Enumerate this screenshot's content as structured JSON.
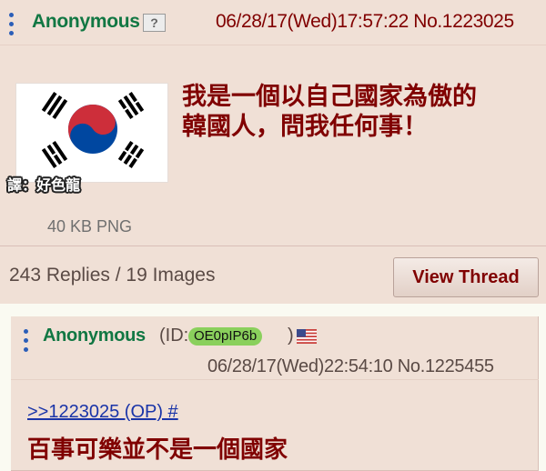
{
  "op": {
    "name": "Anonymous",
    "help_badge": "?",
    "datetime": "06/28/17(Wed)17:57:22 No.1223025",
    "image_credit": "譯：好色龍",
    "file_info": "40 KB PNG",
    "comment_line1": "我是一個以自己國家為傲的",
    "comment_line2": "韓國人，問我任何事！",
    "replies_summary": "243 Replies / 19 Images",
    "view_thread_label": "View Thread"
  },
  "reply": {
    "name": "Anonymous",
    "id_prefix": "(ID:",
    "poster_id": "OE0pIP6b",
    "id_suffix": ")",
    "flag_icon": "us-flag-icon",
    "datetime": "06/28/17(Wed)22:54:10 No.1225455",
    "quotelink": ">>1223025 (OP) #",
    "comment": "百事可樂並不是一個國家"
  },
  "colors": {
    "post_bg": "#f0e0d6",
    "name_green": "#117743",
    "maroon": "#800000",
    "link_blue": "#1a34a8",
    "id_pill_green": "#8ad05c"
  }
}
